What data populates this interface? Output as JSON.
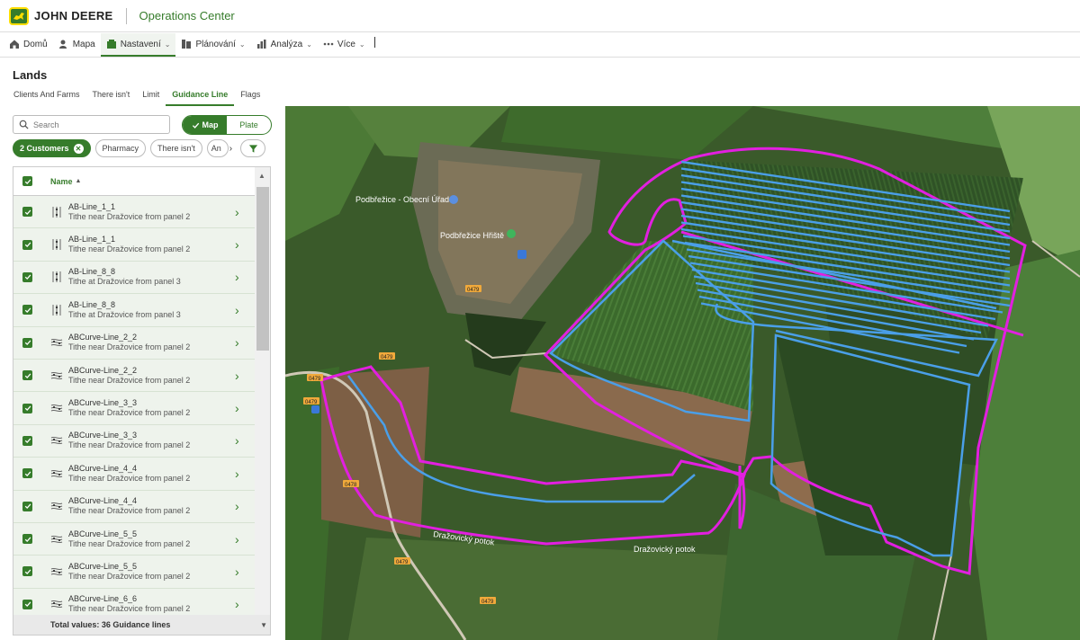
{
  "header": {
    "brand": "JOHN DEERE",
    "app_title": "Operations Center"
  },
  "nav": [
    {
      "label": "Domů",
      "icon": "home-icon",
      "caret": false,
      "active": false
    },
    {
      "label": "Mapa",
      "icon": "map-pin-icon",
      "caret": false,
      "active": false
    },
    {
      "label": "Nastavení",
      "icon": "settings-icon",
      "caret": true,
      "active": true
    },
    {
      "label": "Plánování",
      "icon": "planning-icon",
      "caret": true,
      "active": false
    },
    {
      "label": "Analýza",
      "icon": "analysis-icon",
      "caret": true,
      "active": false
    },
    {
      "label": "Více",
      "icon": "more-icon",
      "caret": true,
      "active": false
    }
  ],
  "page": {
    "title": "Lands",
    "tabs": [
      "Clients And Farms",
      "There isn't",
      "Limit",
      "Guidance Line",
      "Flags"
    ],
    "active_tab": "Guidance Line"
  },
  "search": {
    "placeholder": "Search"
  },
  "view_toggle": {
    "map": "Map",
    "plate": "Plate",
    "selected": "Map"
  },
  "filters": {
    "selected_chip": "2 Customers",
    "chips": [
      "Pharmacy",
      "There isn't",
      "An"
    ]
  },
  "list": {
    "column_name": "Name",
    "sort": "ascending",
    "rows": [
      {
        "name": "AB-Line_1_1",
        "desc": "Tithe near Dražovice from panel 2",
        "type": "ab-line-icon"
      },
      {
        "name": "AB-Line_1_1",
        "desc": "Tithe near Dražovice from panel 2",
        "type": "ab-line-icon"
      },
      {
        "name": "AB-Line_8_8",
        "desc": "Tithe at Dražovice from panel 3",
        "type": "ab-line-icon"
      },
      {
        "name": "AB-Line_8_8",
        "desc": "Tithe at Dražovice from panel 3",
        "type": "ab-line-icon"
      },
      {
        "name": "ABCurve-Line_2_2",
        "desc": "Tithe near Dražovice from panel 2",
        "type": "ab-curve-icon"
      },
      {
        "name": "ABCurve-Line_2_2",
        "desc": "Tithe near Dražovice from panel 2",
        "type": "ab-curve-icon"
      },
      {
        "name": "ABCurve-Line_3_3",
        "desc": "Tithe near Dražovice from panel 2",
        "type": "ab-curve-icon"
      },
      {
        "name": "ABCurve-Line_3_3",
        "desc": "Tithe near Dražovice from panel 2",
        "type": "ab-curve-icon"
      },
      {
        "name": "ABCurve-Line_4_4",
        "desc": "Tithe near Dražovice from panel 2",
        "type": "ab-curve-icon"
      },
      {
        "name": "ABCurve-Line_4_4",
        "desc": "Tithe near Dražovice from panel 2",
        "type": "ab-curve-icon"
      },
      {
        "name": "ABCurve-Line_5_5",
        "desc": "Tithe near Dražovice from panel 2",
        "type": "ab-curve-icon"
      },
      {
        "name": "ABCurve-Line_5_5",
        "desc": "Tithe near Dražovice from panel 2",
        "type": "ab-curve-icon"
      },
      {
        "name": "ABCurve-Line_6_6",
        "desc": "Tithe near Dražovice from panel 2",
        "type": "ab-curve-icon"
      }
    ],
    "footer": "Total values: 36 Guidance lines"
  },
  "map": {
    "labels": {
      "village_office": "Podbřežice - Obecní Úřad",
      "playground": "Podbřežice Hřiště",
      "stream_1": "Dražovický potok",
      "stream_2": "Dražovický potok",
      "road": "0479",
      "road2": "0478"
    },
    "colors": {
      "boundary": "#e21fe0",
      "guidance": "#4a9fe8",
      "accent": "#367c2b",
      "brand_yellow": "#ffde00"
    }
  }
}
